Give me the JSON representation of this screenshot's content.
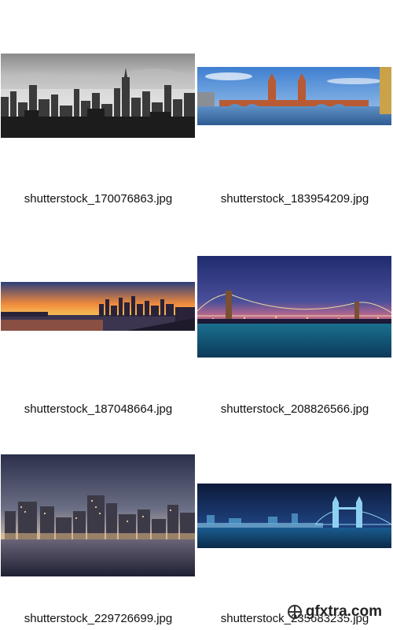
{
  "gallery": {
    "items": [
      {
        "filename": "shutterstock_170076863.jpg",
        "thumb_icon": "new-york-bw-skyline-image"
      },
      {
        "filename": "shutterstock_183954209.jpg",
        "thumb_icon": "oberbaum-bridge-image"
      },
      {
        "filename": "shutterstock_187048664.jpg",
        "thumb_icon": "sunset-skyline-image"
      },
      {
        "filename": "shutterstock_208826566.jpg",
        "thumb_icon": "brooklyn-bridge-night-image"
      },
      {
        "filename": "shutterstock_229726699.jpg",
        "thumb_icon": "manhattan-night-skyline-image"
      },
      {
        "filename": "shutterstock_235683235.jpg",
        "thumb_icon": "tower-bridge-night-image"
      }
    ]
  },
  "watermark": {
    "text": "gfxtra.com"
  }
}
